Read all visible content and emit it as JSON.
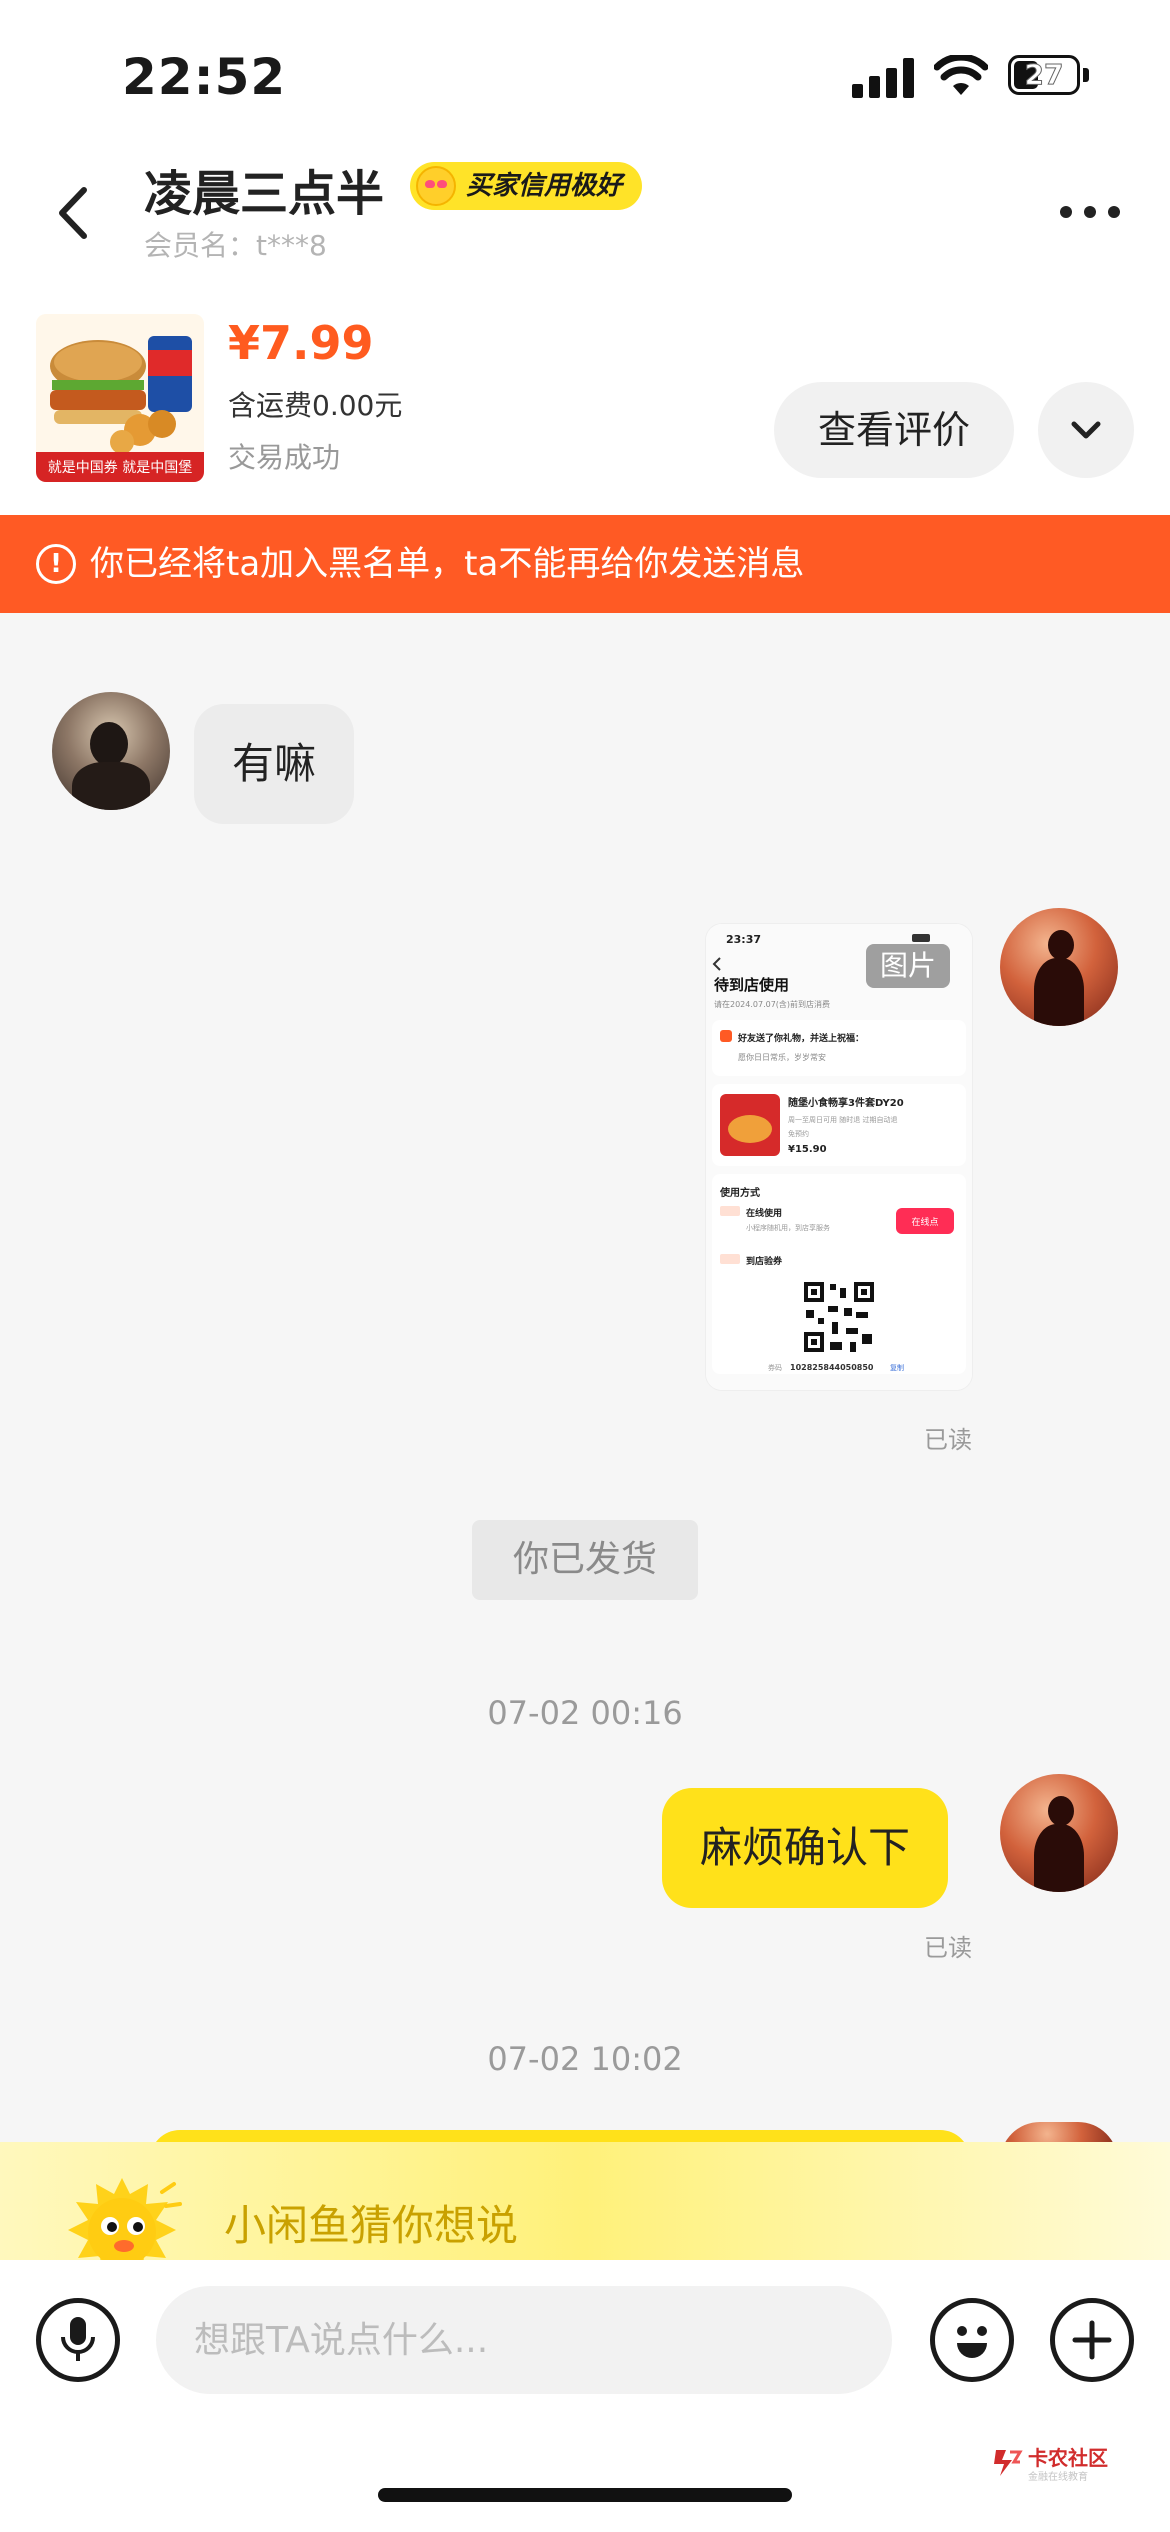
{
  "status_bar": {
    "time": "22:52",
    "battery": "27"
  },
  "header": {
    "peer_name": "凌晨三点半",
    "credit_badge": "买家信用极好",
    "member_label": "会员名：t***8"
  },
  "order": {
    "price": "¥7.99",
    "shipping": "含运费0.00元",
    "status": "交易成功",
    "review_button": "查看评价",
    "thumb_banner": "就是中国券 就是中国堡"
  },
  "banner": {
    "text": "你已经将ta加入黑名单，ta不能再给你发送消息"
  },
  "messages": {
    "peer_text": "有嘛",
    "image_tag": "图片",
    "read_1": "已读",
    "system_shipped": "你已发货",
    "time_1": "07-02 00:16",
    "me_text": "麻烦确认下",
    "read_2": "已读",
    "time_2": "07-02 10:02"
  },
  "screenshot_content": {
    "time": "23:37",
    "title": "待到店使用",
    "subtitle": "请在2024.07.07(含)前到店消费",
    "gift_line": "好友送了你礼物，并送上祝福：",
    "gift_wish": "愿你日日常乐，岁岁常安",
    "product_name": "随堡小食畅享3件套DY20",
    "product_detail": "周一至周日可用  随时退  过期自动退",
    "product_detail_2": "免预约",
    "product_price": "¥15.90",
    "usage_title": "使用方式",
    "online_title": "在线使用",
    "online_desc": "小程序随机用，到店享服务",
    "online_button": "在线点",
    "store_title": "到店验券",
    "code_label": "券码",
    "code": "102825844050850",
    "copy": "复制"
  },
  "suggest": {
    "text": "小闲鱼猜你想说"
  },
  "input": {
    "placeholder": "想跟TA说点什么..."
  },
  "watermark": {
    "title": "卡农社区",
    "subtitle": "金融在线教育"
  },
  "colors": {
    "accent_yellow": "#ffe11a",
    "price_orange": "#ff5b1f",
    "banner_orange": "#ff5a24"
  }
}
